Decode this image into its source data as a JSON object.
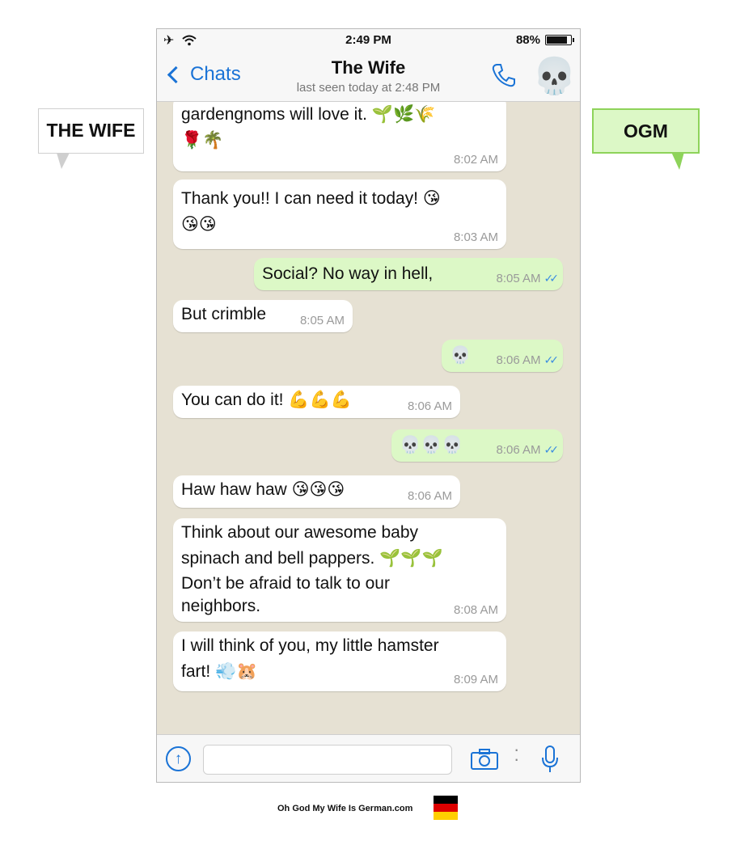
{
  "status": {
    "time": "2:49 PM",
    "battery": "88%",
    "battery_level": 0.88
  },
  "nav": {
    "back_label": "Chats",
    "title": "The Wife",
    "subtitle": "last seen today at 2:48 PM",
    "avatar_emoji": "💀"
  },
  "labels": {
    "wife": "THE WIFE",
    "ogm": "OGM"
  },
  "messages": [
    {
      "dir": "in",
      "text": "gardengnoms will love it.",
      "emoji": "🌱🌿🌾",
      "emoji2": "🌹🌴",
      "time": "8:02 AM"
    },
    {
      "dir": "in",
      "text": "Thank you!! I can need it today!",
      "emoji": "😘",
      "emoji2": "😘😘",
      "time": "8:03 AM"
    },
    {
      "dir": "out",
      "text": "Social? No way in hell,",
      "time": "8:05 AM"
    },
    {
      "dir": "in",
      "text": "But crimble",
      "time": "8:05 AM"
    },
    {
      "dir": "out",
      "text": "",
      "emoji": "💀",
      "time": "8:06 AM"
    },
    {
      "dir": "in",
      "text": "You can do it!",
      "emoji": "💪💪💪",
      "time": "8:06 AM"
    },
    {
      "dir": "out",
      "text": "",
      "emoji": "💀💀💀",
      "time": "8:06 AM"
    },
    {
      "dir": "in",
      "text": "Haw haw haw",
      "emoji": "😘😘😘",
      "time": "8:06 AM"
    },
    {
      "dir": "in",
      "line1": "Think about our awesome baby",
      "line2": "spinach and bell pappers.",
      "emoji": "🌱🌱🌱",
      "line3": "Don’t be afraid to talk to our",
      "line4": "neighbors.",
      "time": "8:08 AM"
    },
    {
      "dir": "in",
      "line1": "I will think of you, my little hamster",
      "line2": "fart!",
      "emoji": "💨🐹",
      "time": "8:09 AM"
    }
  ],
  "footer": {
    "text": "Oh God My Wife Is German.com"
  },
  "colors": {
    "accent": "#1a73d6",
    "outgoing": "#dcf8c6",
    "incoming": "#ffffff",
    "ticks": "#3b8de0"
  }
}
